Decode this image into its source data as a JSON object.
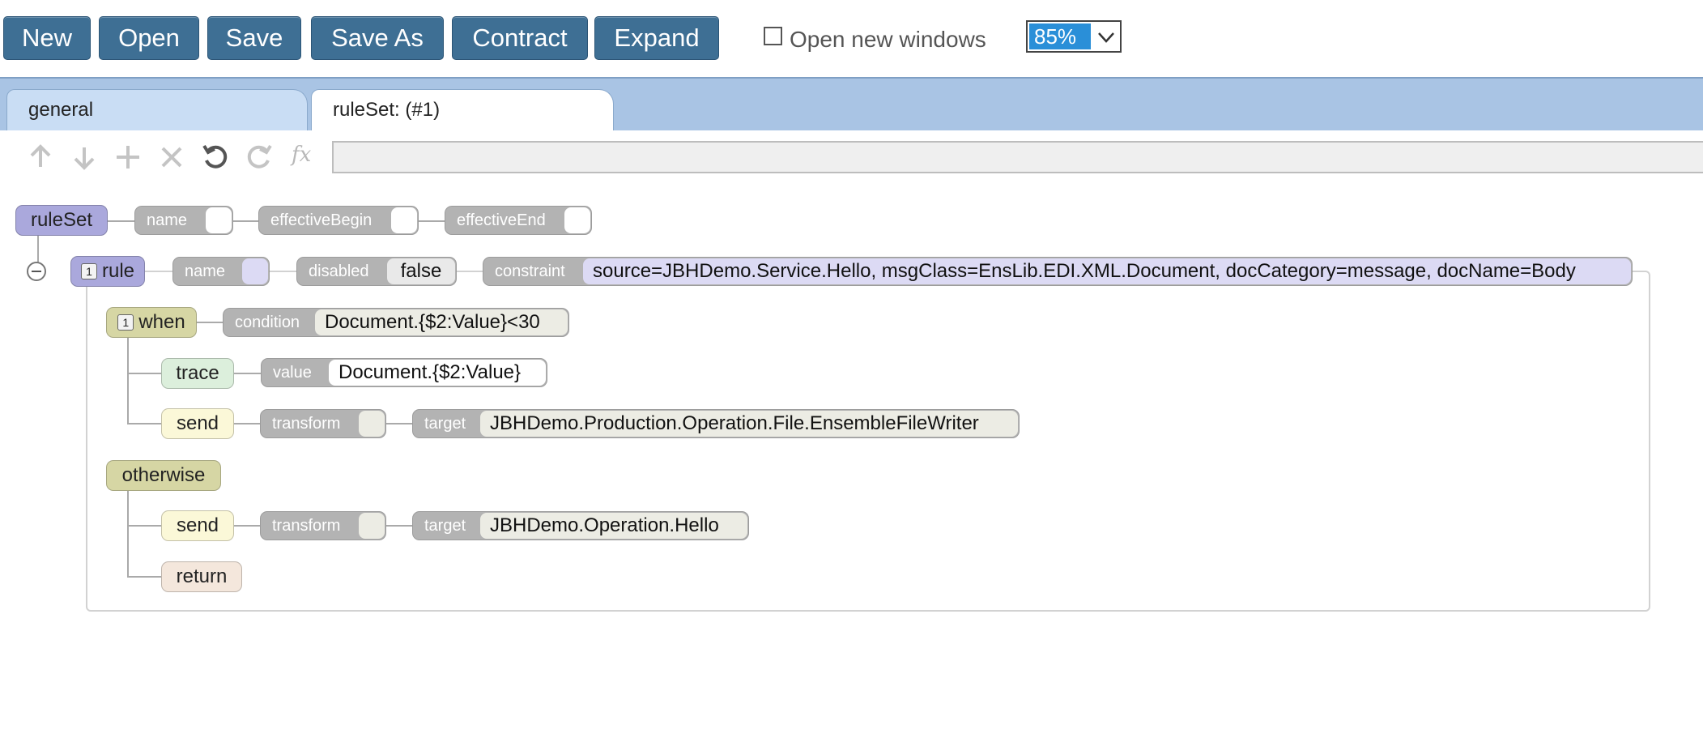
{
  "toolbar": {
    "new": "New",
    "open": "Open",
    "save": "Save",
    "save_as": "Save As",
    "contract": "Contract",
    "expand": "Expand",
    "open_new_windows": "Open new windows",
    "zoom": "85%"
  },
  "tabs": {
    "general": "general",
    "ruleset": "ruleSet: (#1)"
  },
  "edit_tools": [
    "arrow-up-icon",
    "arrow-down-icon",
    "plus-icon",
    "close-icon",
    "undo-icon",
    "redo-icon",
    "function-icon"
  ],
  "fx_symbol": "fx",
  "tree": {
    "ruleset": {
      "label": "ruleSet",
      "props": {
        "name": "name",
        "effective_begin": "effectiveBegin",
        "effective_end": "effectiveEnd"
      }
    },
    "rule": {
      "badge": "1",
      "label": "rule",
      "props": {
        "name": "name",
        "disabled": "disabled",
        "disabled_value": "false",
        "constraint": "constraint",
        "constraint_value": "source=JBHDemo.Service.Hello, msgClass=EnsLib.EDI.XML.Document, docCategory=message, docName=Body"
      }
    },
    "when": {
      "badge": "1",
      "label": "when",
      "condition": "condition",
      "condition_value": "Document.{$2:Value}<30"
    },
    "trace": {
      "label": "trace",
      "value_label": "value",
      "value": "Document.{$2:Value}"
    },
    "send1": {
      "label": "send",
      "transform": "transform",
      "target": "target",
      "target_value": "JBHDemo.Production.Operation.File.EnsembleFileWriter"
    },
    "otherwise": {
      "label": "otherwise"
    },
    "send2": {
      "label": "send",
      "transform": "transform",
      "target": "target",
      "target_value": "JBHDemo.Operation.Hello"
    },
    "return": {
      "label": "return"
    }
  }
}
